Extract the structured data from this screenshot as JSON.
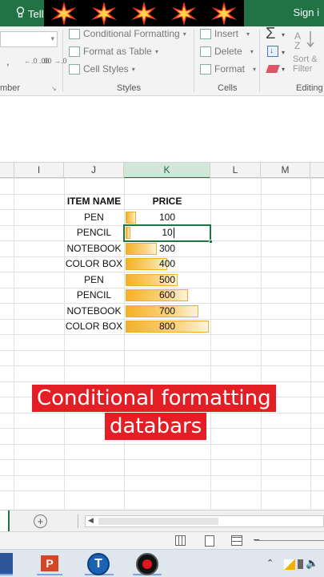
{
  "app": {
    "tell_me_label": "Tell",
    "sign_in_label": "Sign i"
  },
  "ribbon": {
    "number": {
      "comma_label": ",",
      "increase_decimal_label": "←.0 .00",
      "decrease_decimal_label": ".00 →.0",
      "group_label": "mber"
    },
    "styles": {
      "conditional_formatting_label": "Conditional Formatting",
      "format_as_table_label": "Format as Table",
      "cell_styles_label": "Cell Styles",
      "group_label": "Styles"
    },
    "cells": {
      "insert_label": "Insert",
      "delete_label": "Delete",
      "format_label": "Format",
      "group_label": "Cells"
    },
    "editing": {
      "sum_label": "Σ",
      "sort_filter_line1": "Sort &",
      "sort_filter_line2": "Filter",
      "group_label": "Editing"
    }
  },
  "columns": [
    "I",
    "J",
    "K",
    "L",
    "M"
  ],
  "selected_column": "K",
  "table": {
    "headers": {
      "item": "ITEM NAME",
      "price": "PRICE"
    },
    "rows": [
      {
        "item": "PEN",
        "price": "100",
        "value": 100
      },
      {
        "item": "PENCIL",
        "price": "10",
        "value": 10
      },
      {
        "item": "NOTEBOOK",
        "price": "300",
        "value": 300
      },
      {
        "item": "COLOR BOX",
        "price": "400",
        "value": 400
      },
      {
        "item": "PEN",
        "price": "500",
        "value": 500
      },
      {
        "item": "PENCIL",
        "price": "600",
        "value": 600
      },
      {
        "item": "NOTEBOOK",
        "price": "700",
        "value": 700
      },
      {
        "item": "COLOR BOX",
        "price": "800",
        "value": 800
      }
    ],
    "max_value": 800,
    "active_row_index": 1
  },
  "caption": {
    "line1": "Conditional formatting",
    "line2": "databars"
  },
  "colors": {
    "excel_green": "#217346",
    "caption_red": "#e31e24",
    "databar_orange": "#f5b026"
  },
  "sheetbar": {
    "add_sheet_label": "+"
  }
}
